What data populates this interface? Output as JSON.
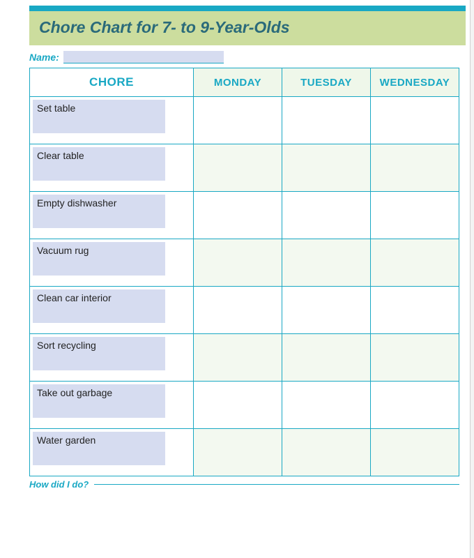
{
  "title": "Chore Chart for 7- to 9-Year-Olds",
  "name_label": "Name:",
  "headers": {
    "chore": "CHORE",
    "days": [
      "MONDAY",
      "TUESDAY",
      "WEDNESDAY"
    ]
  },
  "chores": [
    "Set table",
    "Clear table",
    "Empty dishwasher",
    "Vacuum rug",
    "Clean car interior",
    "Sort recycling",
    "Take out garbage",
    "Water garden"
  ],
  "footer": "How did I do?"
}
